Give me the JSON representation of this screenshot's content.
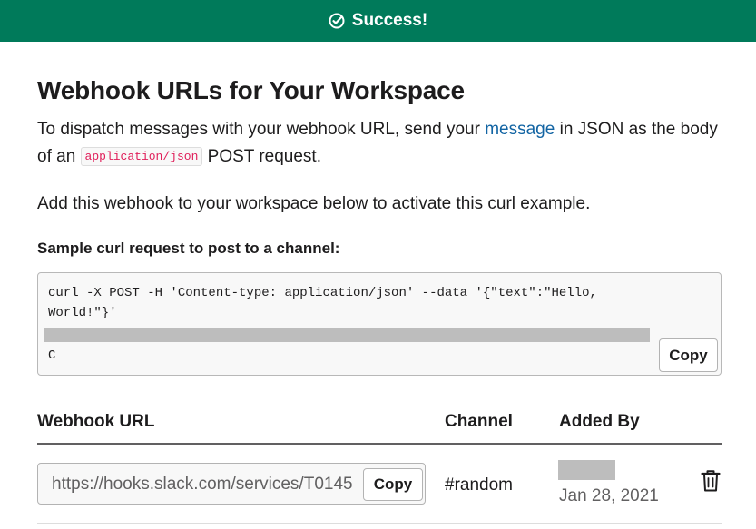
{
  "banner": {
    "text": "Success!"
  },
  "page": {
    "title": "Webhook URLs for Your Workspace",
    "intro_before_link": "To dispatch messages with your webhook URL, send your ",
    "intro_link": "message",
    "intro_after_link": " in JSON as the body of an ",
    "intro_code": "application/json",
    "intro_end": " POST request.",
    "activate_text": "Add this webhook to your workspace below to activate this curl example."
  },
  "sample": {
    "label": "Sample curl request to post to a channel:",
    "line1": "curl -X POST -H 'Content-type: application/json' --data '{\"text\":\"Hello,",
    "line2": "World!\"}'",
    "line3": "C",
    "copy_label": "Copy"
  },
  "table": {
    "headers": {
      "url": "Webhook URL",
      "channel": "Channel",
      "added_by": "Added By"
    },
    "rows": [
      {
        "url": "https://hooks.slack.com/services/T0145",
        "copy_label": "Copy",
        "channel": "#random",
        "added_date": "Jan 28, 2021"
      }
    ]
  },
  "colors": {
    "banner": "#007a5a",
    "link": "#1264a3",
    "code": "#e01e5a"
  },
  "icons": {
    "banner": "check-circle-icon",
    "delete": "trash-icon"
  }
}
